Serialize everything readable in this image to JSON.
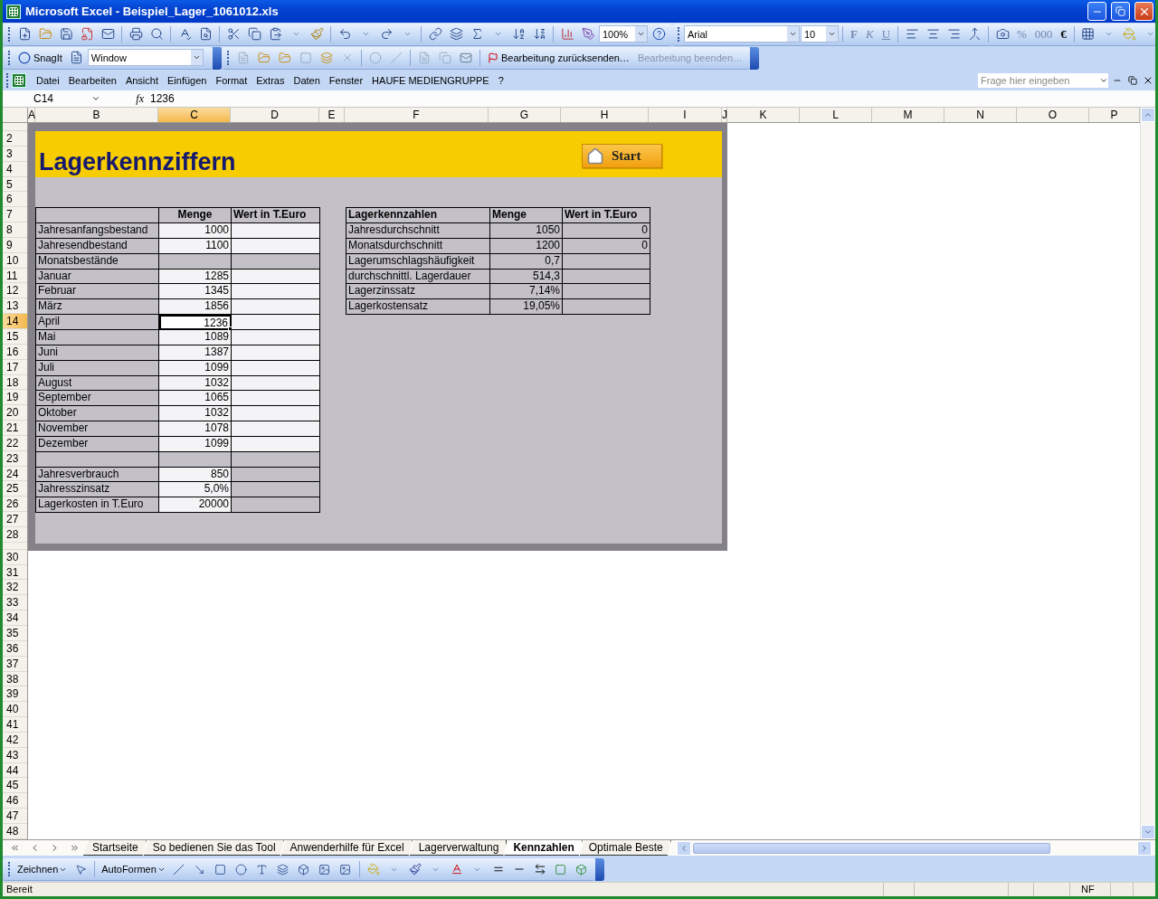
{
  "window": {
    "title": "Microsoft Excel - Beispiel_Lager_1061012.xls"
  },
  "standard_toolbar": {
    "zoom": "100%"
  },
  "format_toolbar": {
    "font": "Arial",
    "font_size": "10",
    "style_buttons": [
      "F",
      "K",
      "U"
    ],
    "number_buttons": [
      "%",
      "000",
      "€"
    ]
  },
  "snagit_toolbar": {
    "snagit_label": "SnagIt",
    "capture_mode": "Window",
    "review_buttons": [
      {
        "label": "Bearbeitung zurücksenden…",
        "disabled": false
      },
      {
        "label": "Bearbeitung beenden…",
        "disabled": true
      }
    ]
  },
  "menu": {
    "items": [
      "Datei",
      "Bearbeiten",
      "Ansicht",
      "Einfügen",
      "Format",
      "Extras",
      "Daten",
      "Fenster",
      "HAUFE MEDIENGRUPPE",
      "?"
    ],
    "help_placeholder": "Frage hier eingeben"
  },
  "formula_bar": {
    "name_box": "C14",
    "function_label": "fx",
    "formula": "1236"
  },
  "columns": [
    {
      "label": "A",
      "selected": false
    },
    {
      "label": "B",
      "selected": false
    },
    {
      "label": "C",
      "selected": true
    },
    {
      "label": "D",
      "selected": false
    },
    {
      "label": "E",
      "selected": false
    },
    {
      "label": "F",
      "selected": false
    },
    {
      "label": "G",
      "selected": false
    },
    {
      "label": "H",
      "selected": false
    },
    {
      "label": "I",
      "selected": false
    },
    {
      "label": "J",
      "selected": false
    },
    {
      "label": "K",
      "selected": false
    },
    {
      "label": "L",
      "selected": false
    },
    {
      "label": "M",
      "selected": false
    },
    {
      "label": "N",
      "selected": false
    },
    {
      "label": "O",
      "selected": false
    },
    {
      "label": "P",
      "selected": false
    }
  ],
  "row_headers_top": [
    {
      "label": "2",
      "selected": false
    },
    {
      "label": "3",
      "selected": false
    },
    {
      "label": "4",
      "selected": false
    },
    {
      "label": "5",
      "selected": false
    },
    {
      "label": "6",
      "selected": false
    },
    {
      "label": "7",
      "selected": false
    },
    {
      "label": "8",
      "selected": false
    },
    {
      "label": "9",
      "selected": false
    },
    {
      "label": "10",
      "selected": false
    },
    {
      "label": "11",
      "selected": false
    },
    {
      "label": "12",
      "selected": false
    },
    {
      "label": "13",
      "selected": false
    },
    {
      "label": "14",
      "selected": true
    },
    {
      "label": "15",
      "selected": false
    },
    {
      "label": "16",
      "selected": false
    },
    {
      "label": "17",
      "selected": false
    },
    {
      "label": "18",
      "selected": false
    },
    {
      "label": "19",
      "selected": false
    },
    {
      "label": "20",
      "selected": false
    },
    {
      "label": "21",
      "selected": false
    },
    {
      "label": "22",
      "selected": false
    },
    {
      "label": "23",
      "selected": false
    },
    {
      "label": "24",
      "selected": false
    },
    {
      "label": "25",
      "selected": false
    },
    {
      "label": "26",
      "selected": false
    },
    {
      "label": "27",
      "selected": false
    },
    {
      "label": "28",
      "selected": false
    }
  ],
  "row_headers_bottom": [
    {
      "label": "30",
      "selected": false
    },
    {
      "label": "31",
      "selected": false
    },
    {
      "label": "32",
      "selected": false
    },
    {
      "label": "33",
      "selected": false
    },
    {
      "label": "34",
      "selected": false
    },
    {
      "label": "35",
      "selected": false
    },
    {
      "label": "36",
      "selected": false
    },
    {
      "label": "37",
      "selected": false
    },
    {
      "label": "38",
      "selected": false
    },
    {
      "label": "39",
      "selected": false
    },
    {
      "label": "40",
      "selected": false
    },
    {
      "label": "41",
      "selected": false
    },
    {
      "label": "42",
      "selected": false
    },
    {
      "label": "43",
      "selected": false
    },
    {
      "label": "44",
      "selected": false
    },
    {
      "label": "45",
      "selected": false
    },
    {
      "label": "46",
      "selected": false
    },
    {
      "label": "47",
      "selected": false
    },
    {
      "label": "48",
      "selected": false
    }
  ],
  "sheet": {
    "title": "Lagerkennziffern",
    "start_button": "Start",
    "left_table": {
      "columns": [
        "Menge",
        "Wert in T.Euro"
      ],
      "rows": [
        {
          "kind": "input",
          "label": "Jahresanfangsbestand",
          "menge": "1000",
          "wert": "",
          "selected": false
        },
        {
          "kind": "input",
          "label": "Jahresendbestand",
          "menge": "1100",
          "wert": "",
          "selected": false
        },
        {
          "kind": "section",
          "label": "Monatsbestände",
          "menge": "",
          "wert": "",
          "selected": false
        },
        {
          "kind": "input",
          "label": "Januar",
          "menge": "1285",
          "wert": "",
          "selected": false
        },
        {
          "kind": "input",
          "label": "Februar",
          "menge": "1345",
          "wert": "",
          "selected": false
        },
        {
          "kind": "input",
          "label": "März",
          "menge": "1856",
          "wert": "",
          "selected": false
        },
        {
          "kind": "input",
          "label": "April",
          "menge": "1236",
          "wert": "",
          "selected": true
        },
        {
          "kind": "input",
          "label": "Mai",
          "menge": "1089",
          "wert": "",
          "selected": false
        },
        {
          "kind": "input",
          "label": "Juni",
          "menge": "1387",
          "wert": "",
          "selected": false
        },
        {
          "kind": "input",
          "label": "Juli",
          "menge": "1099",
          "wert": "",
          "selected": false
        },
        {
          "kind": "input",
          "label": "August",
          "menge": "1032",
          "wert": "",
          "selected": false
        },
        {
          "kind": "input",
          "label": "September",
          "menge": "1065",
          "wert": "",
          "selected": false
        },
        {
          "kind": "input",
          "label": "Oktober",
          "menge": "1032",
          "wert": "",
          "selected": false
        },
        {
          "kind": "input",
          "label": "November",
          "menge": "1078",
          "wert": "",
          "selected": false
        },
        {
          "kind": "input",
          "label": "Dezember",
          "menge": "1099",
          "wert": "",
          "selected": false
        },
        {
          "kind": "section",
          "label": "",
          "menge": "",
          "wert": "",
          "selected": false
        },
        {
          "kind": "summary",
          "label": "Jahresverbrauch",
          "menge": "850",
          "wert": "",
          "selected": false
        },
        {
          "kind": "summary",
          "label": "Jahresszinsatz",
          "menge": "5,0%",
          "wert": "",
          "selected": false
        },
        {
          "kind": "summary",
          "label": "Lagerkosten in T.Euro",
          "menge": "20000",
          "wert": "",
          "selected": false
        }
      ]
    },
    "right_table": {
      "columns": [
        "Lagerkennzahlen",
        "Menge",
        "Wert in T.Euro"
      ],
      "rows": [
        {
          "label": "Jahresdurchschnitt",
          "menge": "1050",
          "wert": "0"
        },
        {
          "label": "Monatsdurchschnitt",
          "menge": "1200",
          "wert": "0"
        },
        {
          "label": "Lagerumschlagshäufigkeit",
          "menge": "0,7",
          "wert": ""
        },
        {
          "label": "durchschnittl. Lagerdauer",
          "menge": "514,3",
          "wert": ""
        },
        {
          "label": "Lagerzinssatz",
          "menge": "7,14%",
          "wert": ""
        },
        {
          "label": "Lagerkostensatz",
          "menge": "19,05%",
          "wert": ""
        }
      ]
    }
  },
  "sheet_tabs": [
    {
      "label": "Startseite",
      "selected": false
    },
    {
      "label": "So bedienen Sie das Tool",
      "selected": false
    },
    {
      "label": "Anwenderhilfe für Excel",
      "selected": false
    },
    {
      "label": "Lagerverwaltung",
      "selected": false
    },
    {
      "label": "Kennzahlen",
      "selected": true
    },
    {
      "label": "Optimale Beste",
      "selected": false
    }
  ],
  "drawing_toolbar": {
    "draw_menu": "Zeichnen",
    "autoshapes_menu": "AutoFormen"
  },
  "status_bar": {
    "status": "Bereit",
    "indicator": "NF"
  }
}
